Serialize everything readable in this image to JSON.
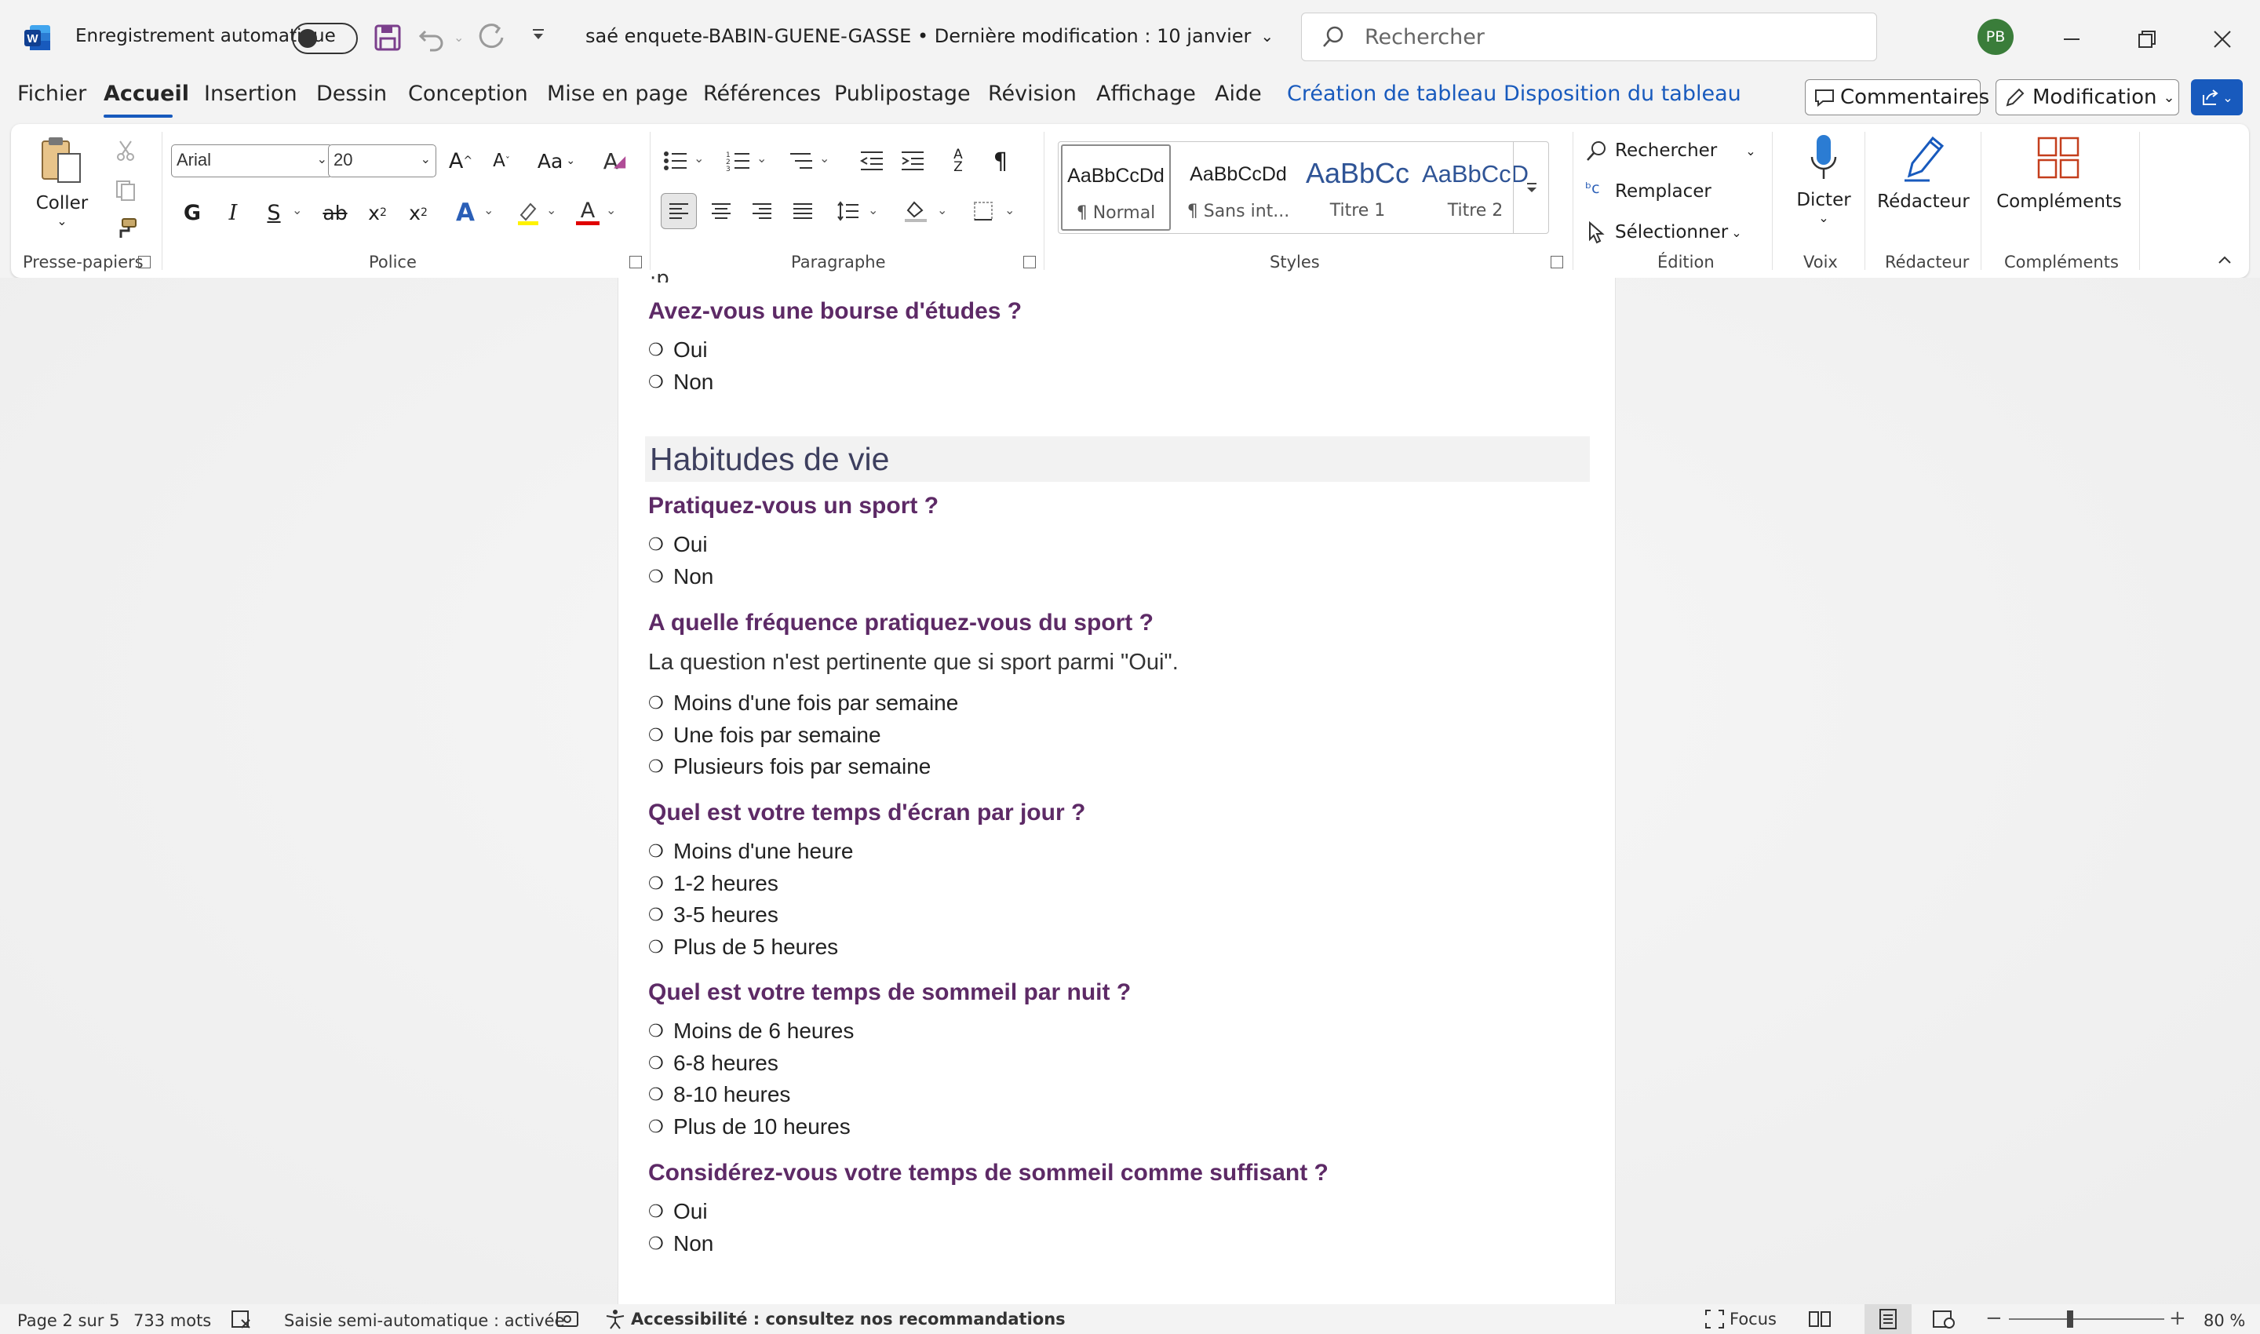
{
  "titlebar": {
    "autosave_label": "Enregistrement automatique",
    "document_title": "saé enquete-BABIN-GUENE-GASSE • Dernière modification : 10 janvier",
    "search_placeholder": "Rechercher",
    "user_initials": "PB"
  },
  "menu": {
    "items": [
      "Fichier",
      "Accueil",
      "Insertion",
      "Dessin",
      "Conception",
      "Mise en page",
      "Références",
      "Publipostage",
      "Révision",
      "Affichage",
      "Aide"
    ],
    "contextual": [
      "Création de tableau",
      "Disposition du tableau"
    ],
    "comments_label": "Commentaires",
    "editing_label": "Modification"
  },
  "ribbon": {
    "clipboard": {
      "paste_label": "Coller",
      "group_label": "Presse-papiers"
    },
    "font": {
      "family": "Arial",
      "size": "20",
      "group_label": "Police",
      "bold": "G",
      "italic": "I",
      "underline": "S",
      "case": "Aa"
    },
    "paragraph": {
      "group_label": "Paragraphe"
    },
    "styles": {
      "group_label": "Styles",
      "items": [
        {
          "preview": "AaBbCcDd",
          "name": "¶ Normal"
        },
        {
          "preview": "AaBbCcDd",
          "name": "¶ Sans int..."
        },
        {
          "preview": "AaBbCc",
          "name": "Titre 1"
        },
        {
          "preview": "AaBbCcD",
          "name": "Titre 2"
        }
      ]
    },
    "editing": {
      "group_label": "Édition",
      "find": "Rechercher",
      "replace": "Remplacer",
      "select": "Sélectionner"
    },
    "voice": {
      "dictate": "Dicter",
      "group_label": "Voix"
    },
    "editor": {
      "label": "Rédacteur",
      "group_label": "Rédacteur"
    },
    "addins": {
      "label": "Compléments",
      "group_label": "Compléments"
    }
  },
  "document": {
    "q_bourse": "Avez-vous une bourse d'études ?",
    "bourse_options": [
      "Oui",
      "Non"
    ],
    "heading": "Habitudes de vie",
    "q_sport": "Pratiquez-vous un sport ?",
    "sport_options": [
      "Oui",
      "Non"
    ],
    "q_frequence": "A quelle fréquence pratiquez-vous du sport ?",
    "frequence_note": "La question n'est pertinente que si sport parmi \"Oui\".",
    "frequence_options": [
      "Moins d'une fois par semaine",
      "Une fois par semaine",
      "Plusieurs fois par semaine"
    ],
    "q_ecran": "Quel est votre temps d'écran par jour ?",
    "ecran_options": [
      "Moins d'une heure",
      "1-2 heures",
      "3-5 heures",
      "Plus de 5 heures"
    ],
    "q_sommeil": "Quel est votre temps de sommeil par nuit ?",
    "sommeil_options": [
      "Moins de 6 heures",
      "6-8 heures",
      "8-10 heures",
      "Plus de 10 heures"
    ],
    "q_suffisant": "Considérez-vous votre temps de sommeil comme suffisant ?",
    "suffisant_options": [
      "Oui",
      "Non"
    ]
  },
  "statusbar": {
    "page": "Page 2 sur 5",
    "words": "733 mots",
    "autocomplete": "Saisie semi-automatique : activée",
    "accessibility": "Accessibilité : consultez nos recommandations",
    "focus": "Focus",
    "zoom": "80 %"
  },
  "colors": {
    "accent": "#185abd",
    "question": "#5d2a66",
    "word_blue": "#2b579a",
    "avatar": "#3a7d3a",
    "addins": "#c43e1c"
  }
}
